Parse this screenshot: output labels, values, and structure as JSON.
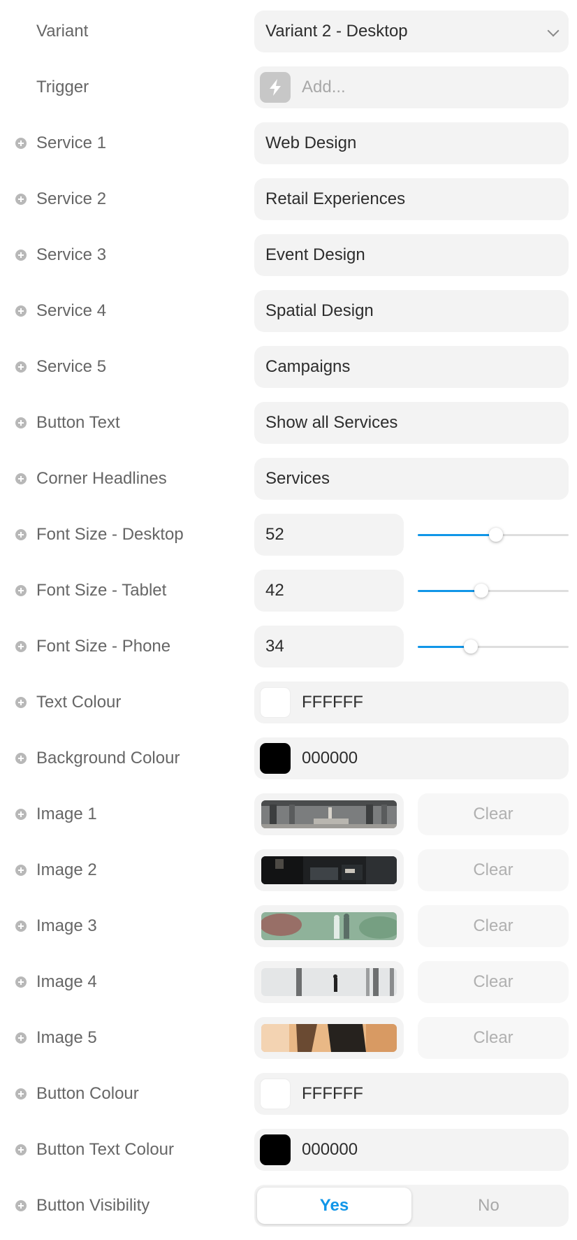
{
  "rows": {
    "variant": {
      "label": "Variant",
      "value": "Variant 2 - Desktop"
    },
    "trigger": {
      "label": "Trigger",
      "placeholder": "Add..."
    },
    "service1": {
      "label": "Service 1",
      "value": "Web Design"
    },
    "service2": {
      "label": "Service 2",
      "value": "Retail Experiences"
    },
    "service3": {
      "label": "Service 3",
      "value": "Event Design"
    },
    "service4": {
      "label": "Service 4",
      "value": "Spatial Design"
    },
    "service5": {
      "label": "Service 5",
      "value": "Campaigns"
    },
    "button_text": {
      "label": "Button Text",
      "value": "Show all Services"
    },
    "corner_headlines": {
      "label": "Corner Headlines",
      "value": "Services"
    },
    "font_desktop": {
      "label": "Font Size - Desktop",
      "value": "52",
      "slider_fraction": 0.52
    },
    "font_tablet": {
      "label": "Font Size - Tablet",
      "value": "42",
      "slider_fraction": 0.42
    },
    "font_phone": {
      "label": "Font Size - Phone",
      "value": "34",
      "slider_fraction": 0.35
    },
    "text_colour": {
      "label": "Text Colour",
      "value": "FFFFFF",
      "color": "#FFFFFF"
    },
    "background_colour": {
      "label": "Background Colour",
      "value": "000000",
      "color": "#000000"
    },
    "image1": {
      "label": "Image 1",
      "clear": "Clear"
    },
    "image2": {
      "label": "Image 2",
      "clear": "Clear"
    },
    "image3": {
      "label": "Image 3",
      "clear": "Clear"
    },
    "image4": {
      "label": "Image 4",
      "clear": "Clear"
    },
    "image5": {
      "label": "Image 5",
      "clear": "Clear"
    },
    "button_colour": {
      "label": "Button Colour",
      "value": "FFFFFF",
      "color": "#FFFFFF"
    },
    "button_text_colour": {
      "label": "Button Text Colour",
      "value": "000000",
      "color": "#000000"
    },
    "button_visibility": {
      "label": "Button Visibility",
      "yes": "Yes",
      "no": "No",
      "selected": "Yes"
    }
  },
  "accent_color": "#1196E8"
}
